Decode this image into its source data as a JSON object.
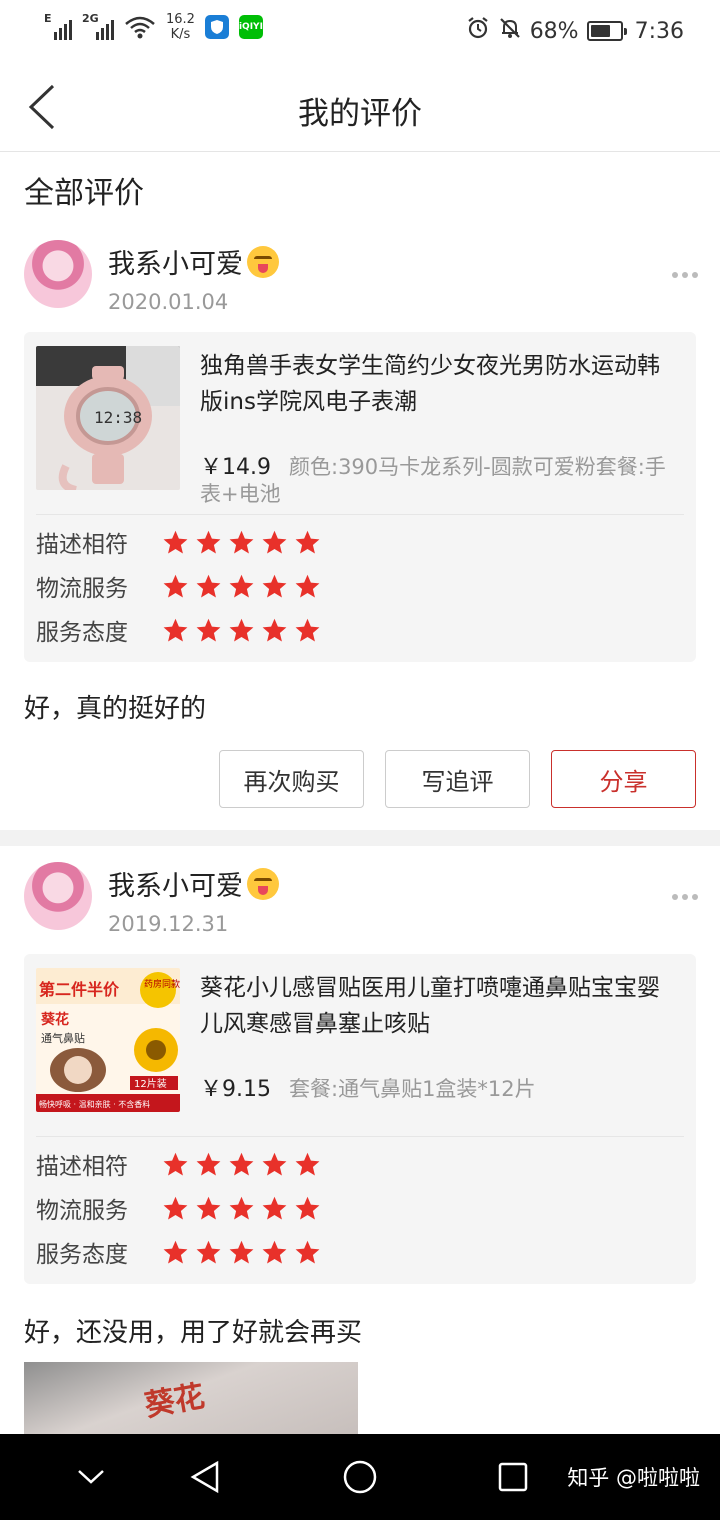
{
  "status_bar": {
    "signal_1": "E",
    "signal_2": "2G",
    "speed_value": "16.2",
    "speed_unit": "K/s",
    "app_icon_1": "shield",
    "app_icon_2": "iQIYI",
    "battery_percent": "68%",
    "battery_level": 0.68,
    "time": "7:36"
  },
  "header": {
    "title": "我的评价"
  },
  "section": {
    "title": "全部评价"
  },
  "reviews": [
    {
      "user_name": "我系小可爱",
      "date": "2020.01.04",
      "product_name": "独角兽手表女学生简约少女夜光男防水运动韩版ins学院风电子表潮",
      "price": "￥14.9",
      "spec": "颜色:390马卡龙系列-圆款可爱粉套餐:手表+电池",
      "ratings": [
        {
          "label": "描述相符",
          "stars": 5
        },
        {
          "label": "物流服务",
          "stars": 5
        },
        {
          "label": "服务态度",
          "stars": 5
        }
      ],
      "text": "好，真的挺好的",
      "buttons": {
        "rebuy": "再次购买",
        "followup": "写追评",
        "share": "分享"
      }
    },
    {
      "user_name": "我系小可爱",
      "date": "2019.12.31",
      "product_name": "葵花小儿感冒贴医用儿童打喷嚏通鼻贴宝宝婴儿风寒感冒鼻塞止咳贴",
      "price": "￥9.15",
      "spec": "套餐:通气鼻贴1盒装*12片",
      "product_image_text": {
        "banner": "第二件半价",
        "badge": "药房同款",
        "brand": "葵花",
        "subtitle": "通气鼻贴",
        "count": "12片装",
        "footer": "畅快呼吸 · 温和亲肤 · 不含香料"
      },
      "ratings": [
        {
          "label": "描述相符",
          "stars": 5
        },
        {
          "label": "物流服务",
          "stars": 5
        },
        {
          "label": "服务态度",
          "stars": 5
        }
      ],
      "text": "好，还没用，用了好就会再买",
      "photo_text": "葵花"
    }
  ],
  "watermark": "知乎 @啦啦啦",
  "colors": {
    "star": "#e8312a",
    "share_border": "#c9302c",
    "muted": "#999999",
    "card_bg": "#f5f5f5"
  }
}
